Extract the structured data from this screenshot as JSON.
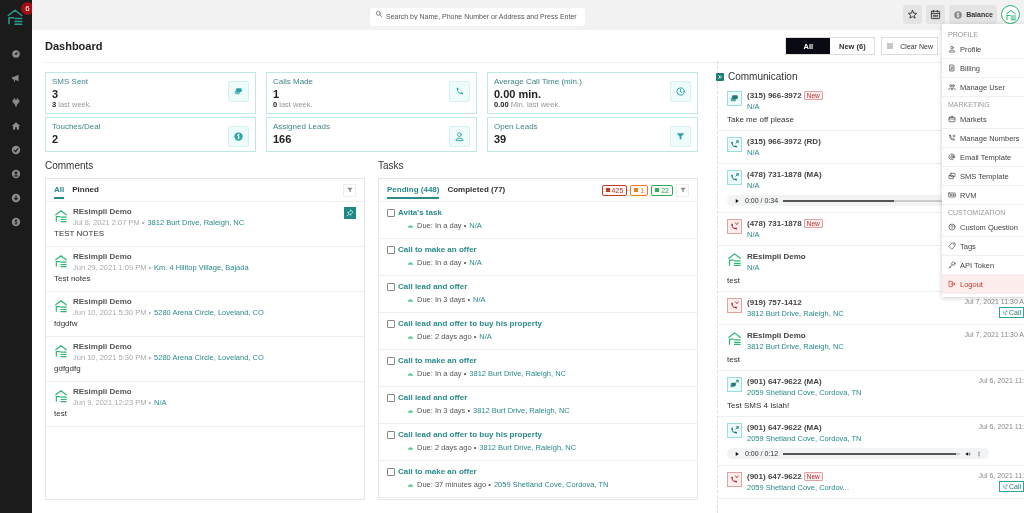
{
  "sidebar": {
    "badge": "6",
    "items": [
      {
        "kind": "gauge"
      },
      {
        "kind": "megaphone"
      },
      {
        "kind": "plug"
      },
      {
        "kind": "home"
      },
      {
        "kind": "check"
      },
      {
        "kind": "user"
      },
      {
        "kind": "download"
      },
      {
        "kind": "dollar"
      }
    ]
  },
  "topbar": {
    "search": {
      "placeholder": "Search by Name, Phone Number or Address and Press Enter"
    },
    "balance": "Balance"
  },
  "header": {
    "title": "Dashboard",
    "filters": [
      {
        "label": "All",
        "selected": true
      },
      {
        "label": "New (6)",
        "selected": false
      }
    ],
    "clear_button": "Clear New"
  },
  "stats": [
    {
      "label": "SMS Sent",
      "value": "3",
      "sub": "**3** last week.",
      "kind": "sms"
    },
    {
      "label": "Calls Made",
      "value": "1",
      "sub": "**0** last week.",
      "kind": "call"
    },
    {
      "label": "Average Call Time (min.)",
      "value": "0.00 min.",
      "sub": "**0.00** Min. last week.",
      "kind": "clock"
    },
    {
      "label": "Touches/Deal",
      "value": "2",
      "kind": "dollar"
    },
    {
      "label": "Assigned Leads",
      "value": "166",
      "kind": "person"
    },
    {
      "label": "Open Leads",
      "value": "39",
      "kind": "funnel"
    }
  ],
  "comments": {
    "title": "Comments",
    "tabs": [
      {
        "label": "All",
        "selected": true
      },
      {
        "label": "Pinned",
        "selected": false
      }
    ],
    "items": [
      {
        "author": "REsimpli Demo",
        "date": "Jul 8, 2021 2:07 PM •",
        "address": "3812 Burt Drive, Raleigh, NC",
        "text": "TEST NOTES",
        "pinned": true
      },
      {
        "author": "REsimpli Demo",
        "date": "Jun 29, 2021 1:09 PM •",
        "address": "Km. 4 Hilltop Village, Bajada",
        "text": "Test notes",
        "pinned": false
      },
      {
        "author": "REsimpli Demo",
        "date": "Jun 10, 2021 5:30 PM •",
        "address": "5280 Arena Circle, Loveland, CO",
        "text": "fdgdfw",
        "pinned": false
      },
      {
        "author": "REsimpli Demo",
        "date": "Jun 10, 2021 5:30 PM •",
        "address": "5280 Arena Circle, Loveland, CO",
        "text": "gdfgdfg",
        "pinned": false
      },
      {
        "author": "REsimpli Demo",
        "date": "Jun 9, 2021 12:23 PM •",
        "address": "N/A",
        "text": "test",
        "pinned": false
      }
    ]
  },
  "tasks": {
    "title": "Tasks",
    "tabs": [
      {
        "label": "Pending (448)",
        "selected": true
      },
      {
        "label": "Completed (77)",
        "selected": false
      }
    ],
    "counters": [
      {
        "value": "425",
        "color": "#c0392b"
      },
      {
        "value": "1",
        "color": "#e67e22"
      },
      {
        "value": "22",
        "color": "#27ae60"
      }
    ],
    "items": [
      {
        "title": "Avita's task",
        "checked": false,
        "due": "Due: In a day •",
        "address": "N/A"
      },
      {
        "title": "Call to make an offer",
        "checked": false,
        "due": "Due: In a day •",
        "address": "N/A"
      },
      {
        "title": "Call lead and offer",
        "checked": false,
        "due": "Due: In 3 days •",
        "address": "N/A"
      },
      {
        "title": "Call lead and offer to buy his property",
        "checked": false,
        "due": "Due: 2 days ago •",
        "address": "N/A"
      },
      {
        "title": "Call to make an offer",
        "checked": false,
        "due": "Due: In a day •",
        "address": "3812 Burt Drive, Raleigh, NC"
      },
      {
        "title": "Call lead and offer",
        "checked": false,
        "due": "Due: In 3 days •",
        "address": "3812 Burt Drive, Raleigh, NC"
      },
      {
        "title": "Call lead and offer to buy his property",
        "checked": false,
        "due": "Due: 2 days ago •",
        "address": "3812 Burt Drive, Raleigh, NC"
      },
      {
        "title": "Call to make an offer",
        "checked": false,
        "due": "Due: 37 minutes ago •",
        "address": "2059 Shetland Cove, Cordova, TN"
      }
    ]
  },
  "communication": {
    "title": "Communication",
    "items": [
      {
        "kind": "sms",
        "contact": "(315) 966-3972",
        "tag": "New",
        "address": "N/A",
        "message": "Take me off please"
      },
      {
        "kind": "call_out",
        "contact": "(315) 966-3972 (RD)",
        "address": "N/A"
      },
      {
        "kind": "call_out",
        "contact": "(478) 731-1878 (MA)",
        "address": "N/A",
        "audio": {
          "time": "0:00 / 0:34",
          "level": 0.47,
          "volume": false
        }
      },
      {
        "kind": "call_missed",
        "contact": "(478) 731-1878",
        "tag": "New",
        "address": "N/A"
      },
      {
        "kind": "note",
        "contact": "REsimpli Demo",
        "address": "N/A",
        "message": "test"
      },
      {
        "kind": "call_missed",
        "contact": "(919) 757-1412",
        "address": "3812 Burt Drive, Raleigh, NC",
        "date": "Jul 7, 2021 11:30 A",
        "badge": "Call"
      },
      {
        "kind": "note",
        "contact": "REsimpli Demo",
        "address": "3812 Burt Drive, Raleigh, NC",
        "message": "test",
        "date": "Jul 7, 2021 11:30 A"
      },
      {
        "kind": "sms_out",
        "contact": "(901) 647-9622 (MA)",
        "address": "2059 Shetland Cove, Cordova, TN",
        "message": "Test SMS 4 Isiah!",
        "date": "Jul 6, 2021 11:"
      },
      {
        "kind": "call_out",
        "contact": "(901) 647-9622 (MA)",
        "address": "2059 Shetland Cove, Cordova, TN",
        "date": "Jul 6, 2021 11:",
        "audio": {
          "time": "0:00 / 0:12",
          "level": 0.98,
          "volume": true
        }
      },
      {
        "kind": "call_missed",
        "contact": "(901) 647-9622",
        "tag": "New",
        "address": "2059 Shetland Cove, Cordov...",
        "date": "Jul 6, 2021 11:",
        "badge": "Call"
      }
    ]
  },
  "menu": {
    "sections": [
      {
        "heading": "PROFILE",
        "items": [
          {
            "label": "Profile",
            "kind": "person"
          },
          {
            "label": "Billing",
            "kind": "receipt"
          },
          {
            "label": "Manage User",
            "kind": "group"
          }
        ]
      },
      {
        "heading": "MARKETING",
        "items": [
          {
            "label": "Markets",
            "kind": "briefcase"
          },
          {
            "label": "Manage Numbers",
            "kind": "phone_plus"
          },
          {
            "label": "Email Template",
            "kind": "at"
          },
          {
            "label": "SMS Template",
            "kind": "copy"
          },
          {
            "label": "RVM",
            "kind": "tape"
          }
        ]
      },
      {
        "heading": "CUSTOMIZATION",
        "items": [
          {
            "label": "Custom Question",
            "kind": "question"
          },
          {
            "label": "Tags",
            "kind": "tag"
          },
          {
            "label": "API Token",
            "kind": "key"
          },
          {
            "label": "Logout",
            "kind": "logout"
          }
        ]
      }
    ]
  }
}
